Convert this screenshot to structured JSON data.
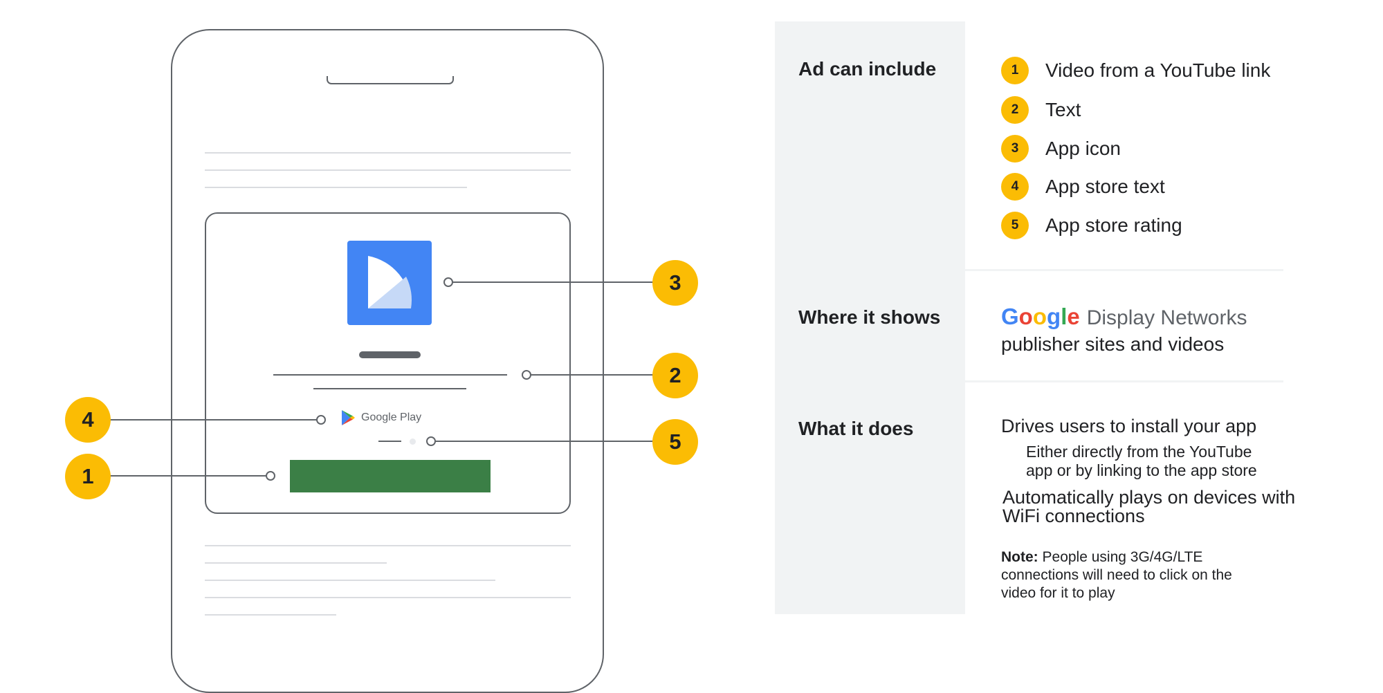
{
  "phone": {
    "store_label": "Google Play"
  },
  "callouts": [
    {
      "num": "3"
    },
    {
      "num": "2"
    },
    {
      "num": "4"
    },
    {
      "num": "5"
    },
    {
      "num": "1"
    }
  ],
  "table": {
    "include": {
      "label": "Ad can include",
      "items": [
        {
          "num": "1",
          "text": "Video from a YouTube link"
        },
        {
          "num": "2",
          "text": "Text"
        },
        {
          "num": "3",
          "text": "App icon"
        },
        {
          "num": "4",
          "text": "App store text"
        },
        {
          "num": "5",
          "text": "App store rating"
        }
      ]
    },
    "where": {
      "label": "Where it shows",
      "logo_letters": [
        "G",
        "o",
        "o",
        "g",
        "l",
        "e"
      ],
      "logo_colors": [
        "#4285F4",
        "#EA4335",
        "#FBBC04",
        "#4285F4",
        "#34A853",
        "#EA4335"
      ],
      "logo_suffix": "Display Networks",
      "subtext": "publisher sites and videos"
    },
    "does": {
      "label": "What it does",
      "line1": "Drives users to install your app",
      "sub1a": "Either directly from the YouTube",
      "sub1b": "app or by linking to the app store",
      "line2a": "Automatically plays on devices with",
      "line2b": "WiFi connections",
      "note_bold": "Note:",
      "note_a": " People using 3G/4G/LTE",
      "note_b": "connections will need to click on the",
      "note_c": "video for it to play"
    }
  },
  "colors": {
    "badge": "#fbbc04",
    "app_icon": "#4285F4",
    "video_bar": "#3b7f46",
    "label_bg": "#f1f3f4"
  }
}
